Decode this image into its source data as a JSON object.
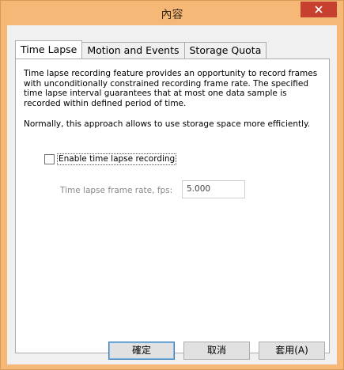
{
  "window": {
    "title": "內容",
    "close_icon": "close-icon",
    "accent_color": "#f5b877",
    "close_color": "#c7402f"
  },
  "tabs": [
    {
      "label": "Time Lapse",
      "active": true
    },
    {
      "label": "Motion and Events",
      "active": false
    },
    {
      "label": "Storage Quota",
      "active": false
    }
  ],
  "panel": {
    "description": "Time lapse recording feature provides an opportunity to record frames with unconditionally constrained recording frame rate. The specified time lapse interval guarantees that at most one data sample is recorded within defined period of time.",
    "description2": "Normally, this approach allows to use storage space more efficiently.",
    "enable_checkbox": {
      "label": "Enable time lapse recording",
      "checked": false
    },
    "frame_rate": {
      "label": "Time lapse frame rate, fps:",
      "value": "5.000",
      "enabled": false
    }
  },
  "buttons": {
    "ok": "確定",
    "cancel": "取消",
    "apply": "套用(A)"
  }
}
